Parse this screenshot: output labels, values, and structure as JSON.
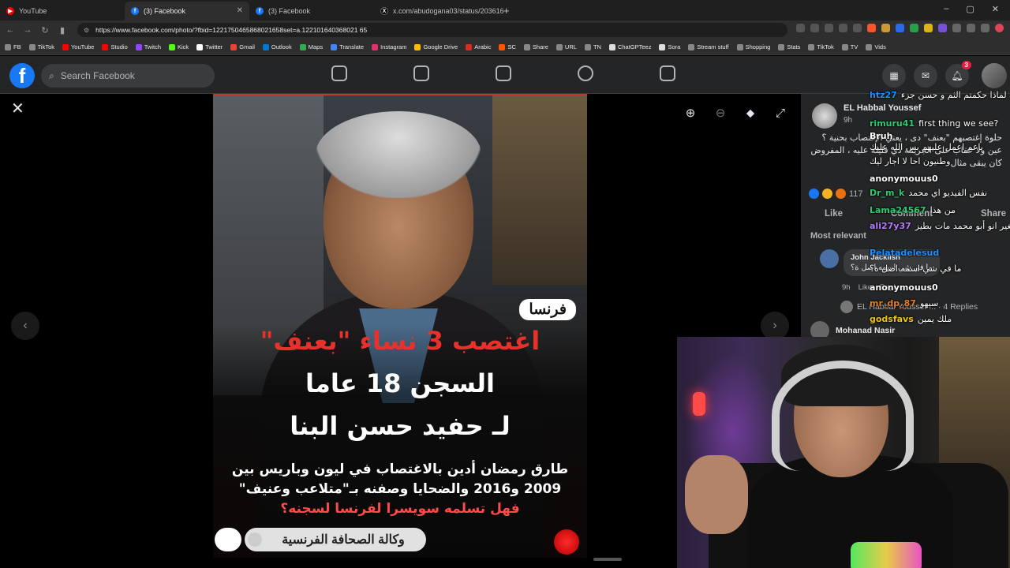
{
  "browser": {
    "tabs": [
      {
        "label": "YouTube",
        "fav_color": "#ff0000",
        "fav_glyph": "▶"
      },
      {
        "label": "(3) Facebook",
        "fav_color": "#1877f2",
        "fav_glyph": "f"
      },
      {
        "label": "(3) Facebook",
        "fav_color": "#1877f2",
        "fav_glyph": "f"
      },
      {
        "label": "x.com/abudogana03/status/203616",
        "fav_color": "#000000",
        "fav_glyph": "X"
      }
    ],
    "new_tab": "+",
    "window_controls": [
      "–",
      "▢",
      "✕"
    ],
    "url": "https://www.facebook.com/photo/?fbid=1221750465868021658set=a.122101640368021 65",
    "bookmarks": [
      {
        "label": "FB",
        "color": "#888888"
      },
      {
        "label": "TikTok",
        "color": "#888888"
      },
      {
        "label": "YouTube",
        "color": "#ff0000"
      },
      {
        "label": "Studio",
        "color": "#ff0000"
      },
      {
        "label": "Twitch",
        "color": "#9146ff"
      },
      {
        "label": "Kick",
        "color": "#53fc18"
      },
      {
        "label": "Twitter",
        "color": "#ffffff"
      },
      {
        "label": "Gmail",
        "color": "#ea4335"
      },
      {
        "label": "Outlook",
        "color": "#0078d4"
      },
      {
        "label": "Maps",
        "color": "#34a853"
      },
      {
        "label": "Translate",
        "color": "#4285f4"
      },
      {
        "label": "Instagram",
        "color": "#e1306c"
      },
      {
        "label": "Google Drive",
        "color": "#fbbc04"
      },
      {
        "label": "Arabic",
        "color": "#d62d20"
      },
      {
        "label": "SC",
        "color": "#ff5500"
      },
      {
        "label": "Share",
        "color": "#888888"
      },
      {
        "label": "URL",
        "color": "#888888"
      },
      {
        "label": "TN",
        "color": "#888888"
      },
      {
        "label": "ChatGPTeez",
        "color": "#dddddd"
      },
      {
        "label": "Sora",
        "color": "#dddddd"
      },
      {
        "label": "Stream stuff",
        "color": "#888888"
      },
      {
        "label": "Shopping",
        "color": "#888888"
      },
      {
        "label": "Stats",
        "color": "#888888"
      },
      {
        "label": "TikTok",
        "color": "#888888"
      },
      {
        "label": "TV",
        "color": "#888888"
      },
      {
        "label": "Vids",
        "color": "#888888"
      }
    ]
  },
  "facebook": {
    "logo": "f",
    "search_placeholder": "Search Facebook",
    "notifications_count": "3"
  },
  "photo": {
    "tag": "فرنسا",
    "headline_red": "اغتصب 3 نساء \"بعنف\"",
    "headline_line2": "السجن 18 عاما",
    "headline_line3": "لـ حفيد حسن البنا",
    "sub1": "طارق رمضان أدين بالاغتصاب في ليون وباريس بين",
    "sub2": "2009 و2016 والضحايا وصفنه بـ\"متلاعب وعنيف\"",
    "sub3": "فهل تسلمه سويسرا لفرنسا لسجنه؟",
    "agency": "وكالة الصحافة الفرنسية"
  },
  "post": {
    "author": "EL Habbal Youssef",
    "time": "9h",
    "caption": "حلوة إغتصبهم \"بعنف\" دى ، يعني الإغتصاب بحنية ؟ عين ولا عقاب على الجريمة دي قليلة عليه ، المفروض كان يبقى مثال",
    "reaction_count": "117",
    "like": "Like",
    "comment": "Comment",
    "share": "Share",
    "sort": "Most relevant",
    "top_comment_author": "John Jacklish",
    "top_comment_text": "ما في شي اسمه اصل ة؟",
    "top_comment_time": "9h",
    "top_comment_like": "Like",
    "top_comment_reply": "Reply",
    "replies_text": "EL Habbal Youssef ... · 4 Replies",
    "next_commenter": "Mohanad Nasir"
  },
  "chat": [
    {
      "user": "htz27",
      "msg": "قصي لماذا حكمتم الثم و حسن جزء",
      "color": "#1e90ff",
      "rtl": true
    },
    {
      "user": "rimuru41",
      "msg": "first thing we see?",
      "color": "#2ecc71",
      "rtl": false
    },
    {
      "user": "Bruh",
      "msg": "",
      "color": "#ffffff",
      "rtl": false
    },
    {
      "user": "",
      "msg": "ياعم اعمل عليهم بس الله عليك",
      "color": "#1e90ff",
      "rtl": true
    },
    {
      "user": "",
      "msg": "وطنيون احا لا اجار ليك",
      "color": "#ffffff",
      "rtl": true
    },
    {
      "user": "anonymouus0",
      "msg": "",
      "color": "#ffffff",
      "rtl": false
    },
    {
      "user": "Dr_m_k",
      "msg": "نفس الفيديو اي محمد",
      "color": "#2ecc71",
      "rtl": true
    },
    {
      "user": "Lama24567",
      "msg": "من هذا",
      "color": "#2ecc71",
      "rtl": true
    },
    {
      "user": "ali27y37",
      "msg": "أنا أهلي دروز قالولي وانا صغير انو أبو محمد مات بطيز",
      "color": "#b57cff",
      "rtl": true
    },
    {
      "user": "Pelatadelesud",
      "msg": "",
      "color": "#1e90ff",
      "rtl": false
    },
    {
      "user": "",
      "msg": "ما في شي اسمه اصل ة؟",
      "color": "#ffffff",
      "rtl": true
    },
    {
      "user": "anonymouus0",
      "msg": "",
      "color": "#ffffff",
      "rtl": false
    },
    {
      "user": "mr_dp_87",
      "msg": "سيهو",
      "color": "#e67e22",
      "rtl": true
    },
    {
      "user": "godsfavs",
      "msg": "ملك يمين",
      "color": "#f1c40f",
      "rtl": true
    }
  ]
}
